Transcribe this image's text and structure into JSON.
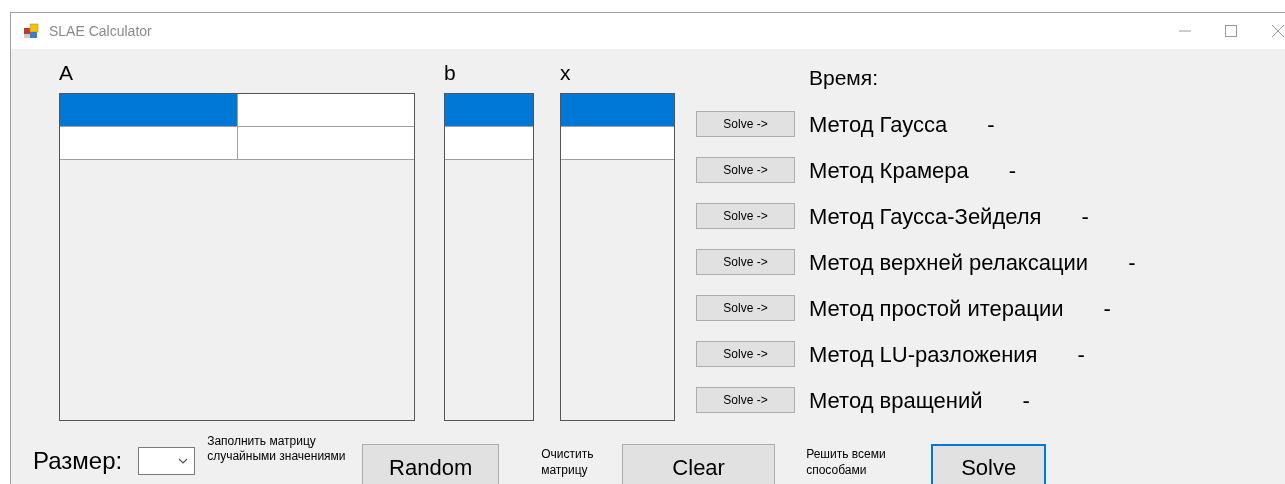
{
  "window": {
    "title": "SLAE Calculator"
  },
  "grids": [
    {
      "label": "A",
      "rows": [
        [
          {
            "selected": true
          },
          {
            "selected": false
          }
        ],
        [
          {
            "selected": false
          },
          {
            "selected": false
          }
        ]
      ]
    },
    {
      "label": "b",
      "rows": [
        [
          {
            "selected": true
          }
        ],
        [
          {
            "selected": false
          }
        ]
      ]
    },
    {
      "label": "x",
      "rows": [
        [
          {
            "selected": true
          }
        ],
        [
          {
            "selected": false
          }
        ]
      ]
    }
  ],
  "time_header": "Время:",
  "methods": [
    {
      "button": "Solve ->",
      "name": "Метод Гаусса",
      "time": "-"
    },
    {
      "button": "Solve ->",
      "name": "Метод Крамера",
      "time": "-"
    },
    {
      "button": "Solve ->",
      "name": "Метод Гаусса-Зейделя",
      "time": "-"
    },
    {
      "button": "Solve ->",
      "name": "Метод верхней релаксации",
      "time": "-"
    },
    {
      "button": "Solve ->",
      "name": "Метод простой итерации",
      "time": "-"
    },
    {
      "button": "Solve ->",
      "name": "Метод LU-разложения",
      "time": "-"
    },
    {
      "button": "Solve ->",
      "name": "Метод вращений",
      "time": "-"
    }
  ],
  "size_label": "Размер:",
  "fill_hint": "Заполнить матрицу случайными значениями",
  "random_button": "Random",
  "clear_hint": "Очистить матрицу",
  "clear_button": "Clear",
  "solve_all_hint": "Решить всеми способами",
  "solve_button": {
    "label": "Solve",
    "focused": true
  }
}
